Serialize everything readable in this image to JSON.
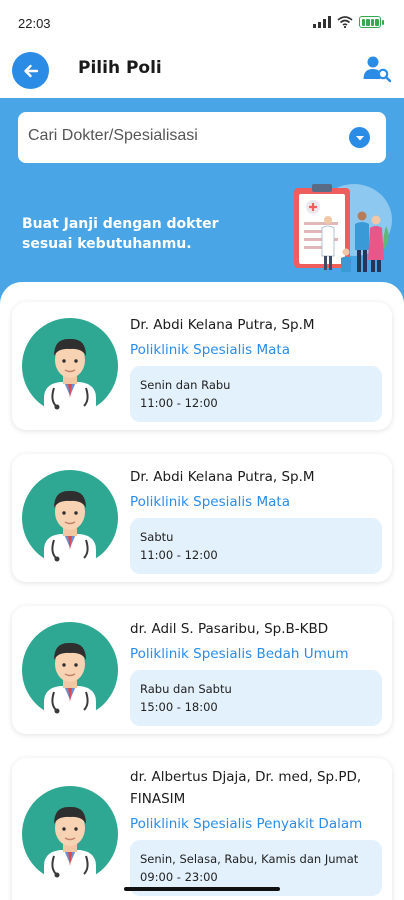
{
  "status_bar": {
    "time": "22:03",
    "icons": [
      "signal-icon",
      "wifi-icon",
      "battery-icon"
    ]
  },
  "header": {
    "title": "Pilih Poli",
    "back_icon": "arrow-left-icon",
    "action_icon": "user-search-icon"
  },
  "hero": {
    "search_placeholder": "Cari Dokter/Spesialisasi",
    "tagline": "Buat Janji dengan dokter sesuai kebutuhanmu.",
    "background_color": "#4aa5e6"
  },
  "doctors": [
    {
      "name": "Dr. Abdi Kelana Putra, Sp.M",
      "poli": "Poliklinik Spesialis Mata",
      "days": "Senin dan Rabu",
      "hours": "11:00 - 12:00"
    },
    {
      "name": "Dr. Abdi Kelana Putra, Sp.M",
      "poli": "Poliklinik Spesialis Mata",
      "days": "Sabtu",
      "hours": "11:00 - 12:00"
    },
    {
      "name": "dr. Adil S. Pasaribu, Sp.B-KBD",
      "poli": "Poliklinik Spesialis Bedah Umum",
      "days": "Rabu dan Sabtu",
      "hours": "15:00 - 18:00"
    },
    {
      "name": "dr. Albertus Djaja, Dr. med, Sp.PD, FINASIM",
      "poli": "Poliklinik Spesialis Penyakit Dalam",
      "days": "Senin, Selasa, Rabu, Kamis dan Jumat",
      "hours": "09:00 - 23:00"
    }
  ],
  "colors": {
    "accent": "#2b8ce6",
    "avatar_bg": "#2fa893",
    "schedule_bg": "#e3f1fc"
  }
}
